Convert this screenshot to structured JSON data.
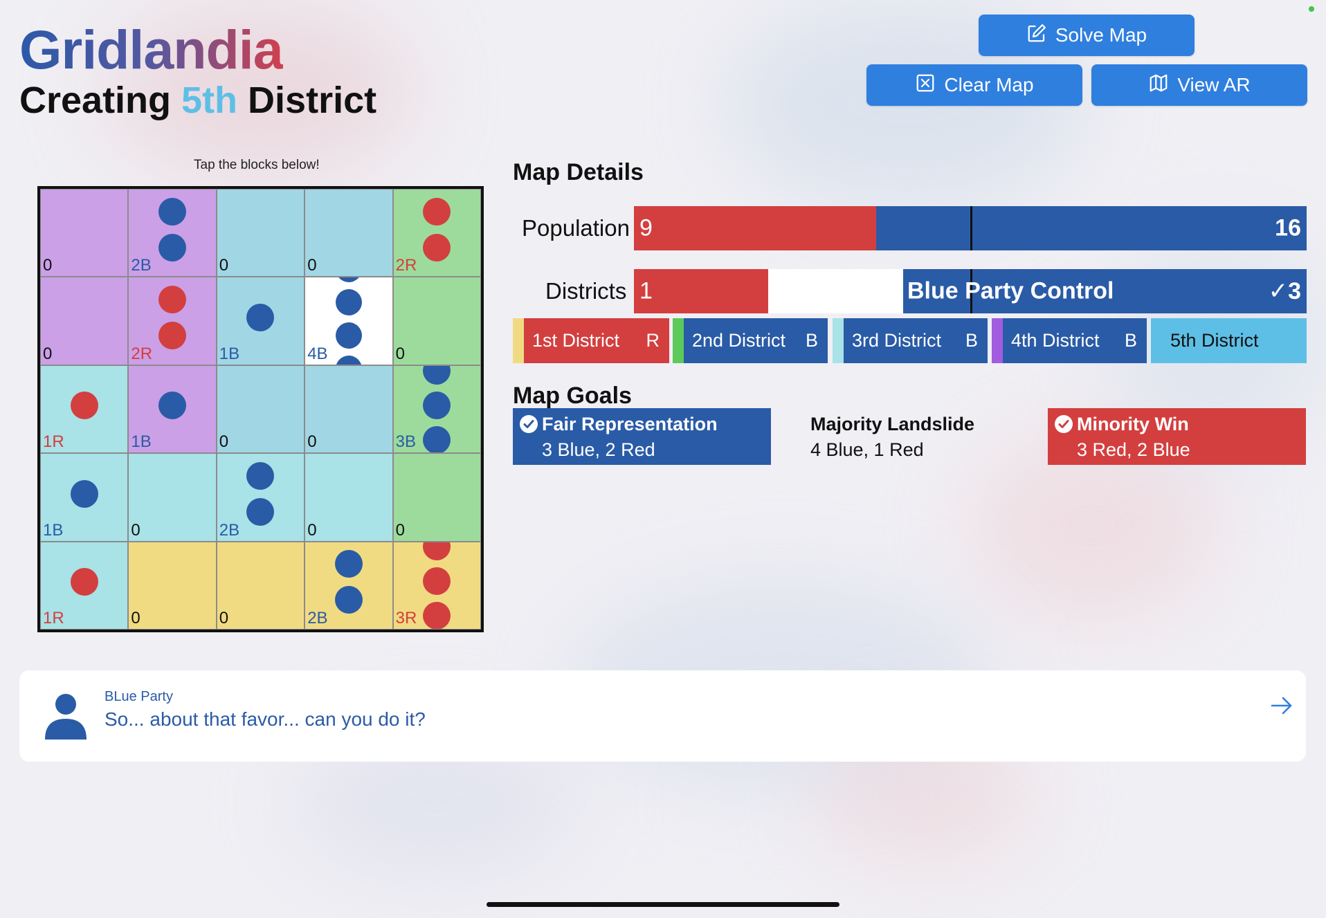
{
  "app": {
    "title": "Gridlandia",
    "subtitle_prefix": "Creating ",
    "subtitle_highlight": "5th",
    "subtitle_suffix": " District"
  },
  "toolbar": {
    "solve_label": "Solve Map",
    "clear_label": "Clear Map",
    "ar_label": "View AR",
    "solve_icon": "pencil-square-icon",
    "clear_icon": "x-square-icon",
    "ar_icon": "map-icon",
    "button_color": "#2f7fdf"
  },
  "board": {
    "hint": "Tap the blocks below!",
    "colors": {
      "purple": "#cba0e7",
      "cyan": "#a9e2e7",
      "blue": "#a1d6e5",
      "green": "#9ddb9c",
      "yellow": "#f1db82",
      "white": "#ffffff"
    },
    "cells": [
      {
        "color": "purple",
        "label": "0",
        "party": "",
        "dots": ""
      },
      {
        "color": "purple",
        "label": "2B",
        "party": "B",
        "dots": "BB"
      },
      {
        "color": "blue",
        "label": "0",
        "party": "",
        "dots": ""
      },
      {
        "color": "blue",
        "label": "0",
        "party": "",
        "dots": ""
      },
      {
        "color": "green",
        "label": "2R",
        "party": "R",
        "dots": "RR"
      },
      {
        "color": "purple",
        "label": "0",
        "party": "",
        "dots": ""
      },
      {
        "color": "purple",
        "label": "2R",
        "party": "R",
        "dots": "RR"
      },
      {
        "color": "blue",
        "label": "1B",
        "party": "B",
        "dots": "B"
      },
      {
        "color": "white",
        "label": "4B",
        "party": "B",
        "dots": "BBBB"
      },
      {
        "color": "green",
        "label": "0",
        "party": "",
        "dots": ""
      },
      {
        "color": "cyan",
        "label": "1R",
        "party": "R",
        "dots": "R"
      },
      {
        "color": "purple",
        "label": "1B",
        "party": "B",
        "dots": "B"
      },
      {
        "color": "blue",
        "label": "0",
        "party": "",
        "dots": ""
      },
      {
        "color": "blue",
        "label": "0",
        "party": "",
        "dots": ""
      },
      {
        "color": "green",
        "label": "3B",
        "party": "B",
        "dots": "BBB"
      },
      {
        "color": "cyan",
        "label": "1B",
        "party": "B",
        "dots": "B"
      },
      {
        "color": "cyan",
        "label": "0",
        "party": "",
        "dots": ""
      },
      {
        "color": "cyan",
        "label": "2B",
        "party": "B",
        "dots": "BB"
      },
      {
        "color": "cyan",
        "label": "0",
        "party": "",
        "dots": ""
      },
      {
        "color": "green",
        "label": "0",
        "party": "",
        "dots": ""
      },
      {
        "color": "cyan",
        "label": "1R",
        "party": "R",
        "dots": "R"
      },
      {
        "color": "yellow",
        "label": "0",
        "party": "",
        "dots": ""
      },
      {
        "color": "yellow",
        "label": "0",
        "party": "",
        "dots": ""
      },
      {
        "color": "yellow",
        "label": "2B",
        "party": "B",
        "dots": "BB"
      },
      {
        "color": "yellow",
        "label": "3R",
        "party": "R",
        "dots": "RRR"
      }
    ]
  },
  "details": {
    "heading": "Map Details",
    "population": {
      "label": "Population",
      "red_value": "9",
      "blue_value": "16",
      "red": 9,
      "total": 25
    },
    "districts": {
      "label": "Districts",
      "red_value": "1",
      "control_text": "Blue Party Control",
      "blue_value": "✓3",
      "red_fraction": 0.2,
      "blue_fraction": 0.6
    },
    "colors": {
      "red": "#d33f3f",
      "blue": "#2a5ba6"
    }
  },
  "districts": [
    {
      "name": "1st District",
      "party": "R",
      "stripe": "#f1db82",
      "fill": "#d33f3f"
    },
    {
      "name": "2nd District",
      "party": "B",
      "stripe": "#5cc95b",
      "fill": "#2a5ba6"
    },
    {
      "name": "3rd District",
      "party": "B",
      "stripe": "#a9e2e7",
      "fill": "#2a5ba6"
    },
    {
      "name": "4th District",
      "party": "B",
      "stripe": "#a25ce0",
      "fill": "#2a5ba6"
    },
    {
      "name": "5th District",
      "party": "",
      "stripe": "#5ebfe6",
      "fill": "#5ebfe6"
    }
  ],
  "goals": {
    "heading": "Map Goals",
    "items": [
      {
        "name": "Fair Representation",
        "sub": "3 Blue, 2 Red",
        "achieved": true,
        "bg": "#2a5ba6"
      },
      {
        "name": "Majority Landslide",
        "sub": "4 Blue, 1 Red",
        "achieved": false,
        "bg": ""
      },
      {
        "name": "Minority Win",
        "sub": "3 Red, 2 Blue",
        "achieved": true,
        "bg": "#d33f3f"
      }
    ]
  },
  "dialog": {
    "speaker": "BLue Party",
    "message": "So... about that favor... can you do it?",
    "next_icon": "arrow-right-icon",
    "avatar_icon": "person-icon"
  }
}
